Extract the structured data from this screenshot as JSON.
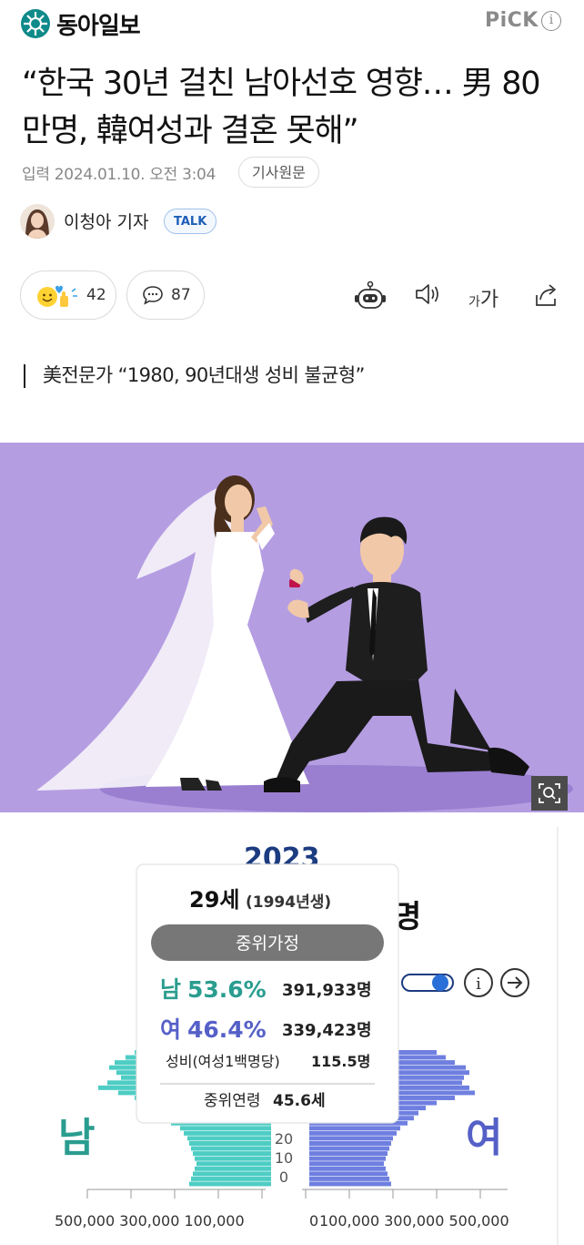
{
  "header": {
    "logo_text": "동아일보",
    "pick_label": "PiCK",
    "info_label": "i"
  },
  "article": {
    "headline": "“한국 30년 걸친 남아선호 영향… 男 80만명, 韓여성과 결혼 못해”",
    "meta": "입력 2024.01.10. 오전 3:04",
    "source_button": "기사원문",
    "reporter": "이청아 기자",
    "talk_button": "TALK",
    "reaction_count": "42",
    "comment_count": "87",
    "font_size_label": {
      "small": "가",
      "big": "가"
    },
    "subheadline": "美전문가 “1980, 90년대생 성비 불균형”"
  },
  "chart_data": {
    "type": "population pyramid",
    "male_label": "남",
    "female_label": "여",
    "y_ticks": [
      "0",
      "10",
      "20"
    ],
    "x_ticks_left": "500,000 300,000 100,000",
    "x_ticks_right_zero": "0",
    "x_ticks_right": "100,000 300,000 500,000",
    "partial_year_label": "2023",
    "partial_title": "명",
    "tooltip": {
      "age": "29세",
      "birth_year": "(1994년생)",
      "category": "중위가정",
      "male_label": "남",
      "male_pct": "53.6%",
      "male_count": "391,933명",
      "female_label": "여",
      "female_pct": "46.4%",
      "female_count": "339,423명",
      "ratio_label": "성비(여성1백명당)",
      "ratio_value": "115.5명",
      "median_label": "중위연령",
      "median_value": "45.6세"
    },
    "colors": {
      "male": "#4ecdc4",
      "female": "#6f7fe0",
      "male_text": "#2a9d8f",
      "female_text": "#5560c7"
    }
  }
}
